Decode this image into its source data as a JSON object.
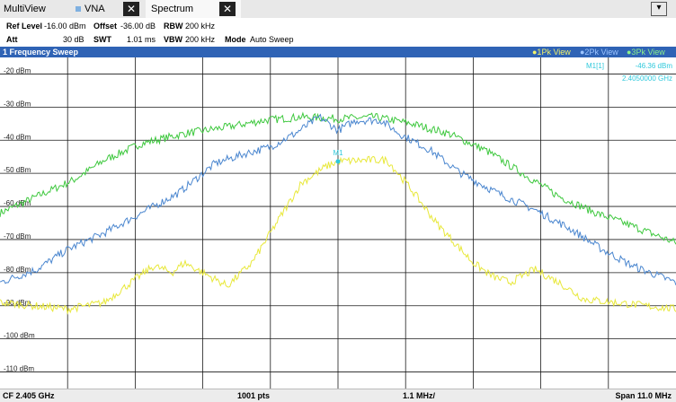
{
  "tabs": {
    "multiview": "MultiView",
    "vna": "VNA",
    "spectrum": "Spectrum",
    "close_glyph": "✕",
    "minimize_glyph": "▾"
  },
  "settings": {
    "ref_level_label": "Ref Level",
    "ref_level_value": "-16.00 dBm",
    "offset_label": "Offset",
    "offset_value": "-36.00 dB",
    "rbw_label": "RBW",
    "rbw_value": "200 kHz",
    "att_label": "Att",
    "att_value": "30 dB",
    "swt_label": "SWT",
    "swt_value": "1.01 ms",
    "vbw_label": "VBW",
    "vbw_value": "200 kHz",
    "mode_label": "Mode",
    "mode_value": "Auto Sweep"
  },
  "window": {
    "title": "1 Frequency Sweep",
    "traces": [
      "●1Pk View",
      "●2Pk View",
      "●3Pk View"
    ]
  },
  "marker": {
    "name": "M1[1]",
    "level": "-46.36 dBm",
    "freq": "2.4050000 GHz",
    "label": "M1"
  },
  "footer": {
    "cf": "CF 2.405 GHz",
    "pts": "1001 pts",
    "div": "1.1 MHz/",
    "span": "Span 11.0 MHz"
  },
  "colors": {
    "trace1": "#e8e83a",
    "trace2": "#4a86cf",
    "trace3": "#3ec83e",
    "marker": "#2fc9dc",
    "title_bar": "#2f63b5"
  },
  "chart_data": {
    "type": "line",
    "x_unit": "GHz",
    "xlim": [
      2.3995,
      2.4105
    ],
    "ylim": [
      -115,
      -15
    ],
    "y_ticks": [
      "-20 dBm",
      "-30 dBm",
      "-40 dBm",
      "-50 dBm",
      "-60 dBm",
      "-70 dBm",
      "-80 dBm",
      "-90 dBm",
      "-100 dBm",
      "-110 dBm"
    ],
    "y_tick_values": [
      -20,
      -30,
      -40,
      -50,
      -60,
      -70,
      -80,
      -90,
      -100,
      -110
    ],
    "x_divisions": 10,
    "grid": true,
    "series": [
      {
        "name": "1Pk View",
        "x": [
          2.3995,
          2.4006,
          2.4012,
          2.4017,
          2.402,
          2.4023,
          2.4025,
          2.4028,
          2.4032,
          2.4036,
          2.404,
          2.4044,
          2.4048,
          2.405,
          2.4055,
          2.4058,
          2.4062,
          2.4066,
          2.4072,
          2.4075,
          2.4078,
          2.4082,
          2.4086,
          2.409,
          2.4105
        ],
        "y": [
          -89,
          -91,
          -89,
          -82,
          -78,
          -80,
          -77,
          -80,
          -84,
          -77,
          -65,
          -53,
          -48,
          -46.4,
          -46,
          -46,
          -55,
          -65,
          -77,
          -81,
          -83,
          -79,
          -83,
          -88,
          -91
        ]
      },
      {
        "name": "2Pk View",
        "x": [
          2.3995,
          2.4001,
          2.4006,
          2.4012,
          2.4018,
          2.4024,
          2.403,
          2.4035,
          2.4039,
          2.4043,
          2.4047,
          2.405,
          2.4053,
          2.4057,
          2.406,
          2.4065,
          2.407,
          2.4076,
          2.4082,
          2.4088,
          2.4093,
          2.4098,
          2.4105
        ],
        "y": [
          -83,
          -79,
          -73,
          -68,
          -62,
          -56,
          -47,
          -44,
          -42,
          -38,
          -33,
          -37,
          -34,
          -34,
          -38,
          -43,
          -50,
          -56,
          -61,
          -67,
          -73,
          -78,
          -83
        ]
      },
      {
        "name": "3Pk View",
        "x": [
          2.3995,
          2.4001,
          2.4007,
          2.4012,
          2.4018,
          2.4025,
          2.4032,
          2.4038,
          2.4044,
          2.405,
          2.4056,
          2.4062,
          2.4068,
          2.4074,
          2.408,
          2.4086,
          2.4092,
          2.4098,
          2.4105
        ],
        "y": [
          -62,
          -57,
          -52,
          -46,
          -41,
          -38,
          -36,
          -34,
          -33,
          -33.5,
          -33,
          -35,
          -38,
          -43,
          -50,
          -57,
          -62,
          -66,
          -71
        ]
      }
    ]
  }
}
